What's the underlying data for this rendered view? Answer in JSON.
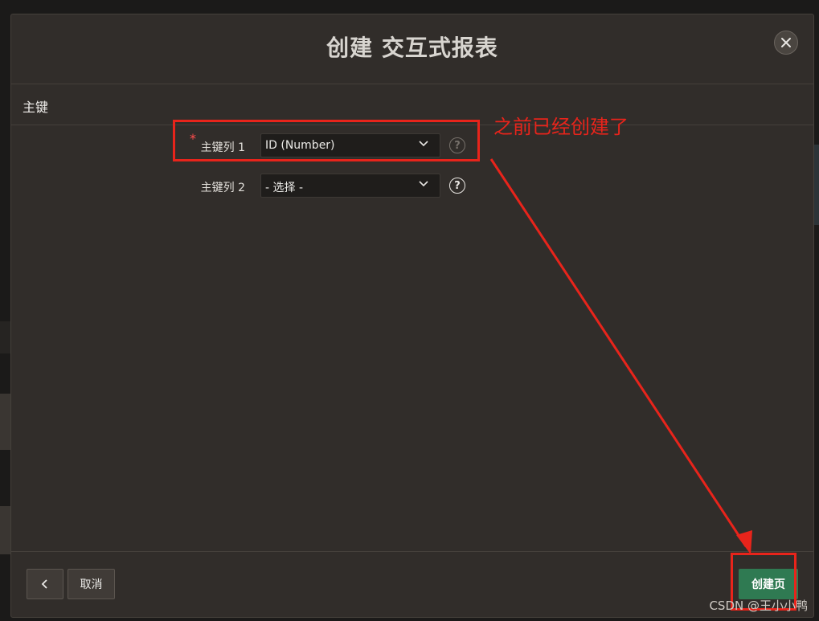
{
  "dialog": {
    "title": "创建 交互式报表",
    "close_icon": "close-icon"
  },
  "section": {
    "title": "主键"
  },
  "form": {
    "pk1": {
      "required_mark": "*",
      "label": "主键列 1",
      "value": "ID (Number)"
    },
    "pk2": {
      "label": "主键列 2",
      "value": "- 选择 -"
    },
    "help_glyph": "?"
  },
  "footer": {
    "back_icon": "chevron-left-icon",
    "cancel_label": "取消",
    "create_label": "创建页"
  },
  "annotation": {
    "note": "之前已经创建了",
    "color": "#e8241b"
  },
  "watermark": "CSDN @王小小鸭",
  "colors": {
    "primary": "#2f7a52",
    "dialog_bg": "#312d2a"
  }
}
